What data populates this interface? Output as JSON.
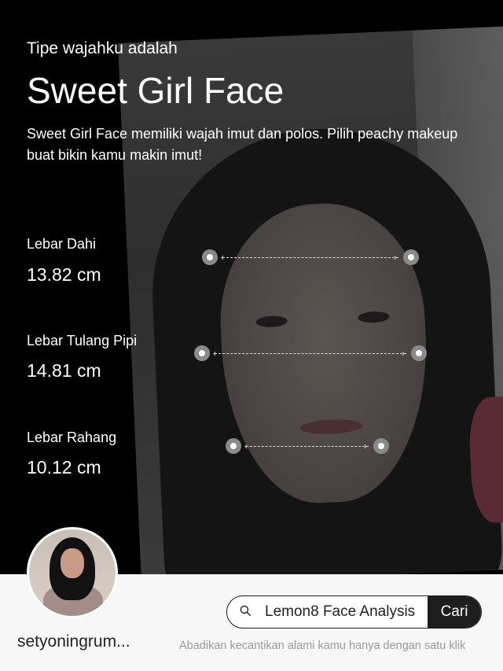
{
  "header": {
    "subtitle": "Tipe wajahku adalah",
    "title": "Sweet Girl Face",
    "description": "Sweet Girl Face memiliki wajah imut dan polos. Pilih peachy makeup buat bikin kamu makin imut!"
  },
  "metrics": [
    {
      "label": "Lebar Dahi",
      "value": "13.82 cm"
    },
    {
      "label": "Lebar Tulang Pipi",
      "value": "14.81 cm"
    },
    {
      "label": "Lebar Rahang",
      "value": "10.12 cm"
    }
  ],
  "footer": {
    "username": "setyoningrum...",
    "search_text": "Lemon8 Face Analysis",
    "search_button": "Cari",
    "tagline": "Abadikan kecantikan alami kamu hanya dengan satu klik"
  },
  "icons": {
    "search": "search-icon",
    "avatar": "user-avatar"
  }
}
